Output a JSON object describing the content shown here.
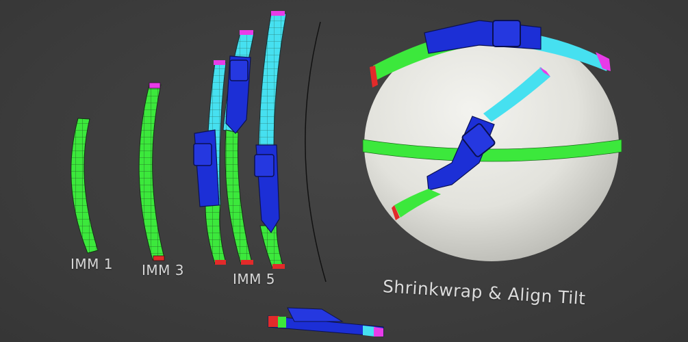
{
  "labels": {
    "imm1": "IMM 1",
    "imm3": "IMM 3",
    "imm5": "IMM 5",
    "shrinkwrap": "Shrinkwrap & Align Tilt"
  },
  "colors": {
    "background": "#3d3d3d",
    "strap_green": "#39e639",
    "strap_cyan": "#46e0f0",
    "buckle_blue": "#1c2fd6",
    "tip_magenta": "#e83be8",
    "tip_red": "#e22a2a",
    "sphere": "#e9e9e4"
  }
}
